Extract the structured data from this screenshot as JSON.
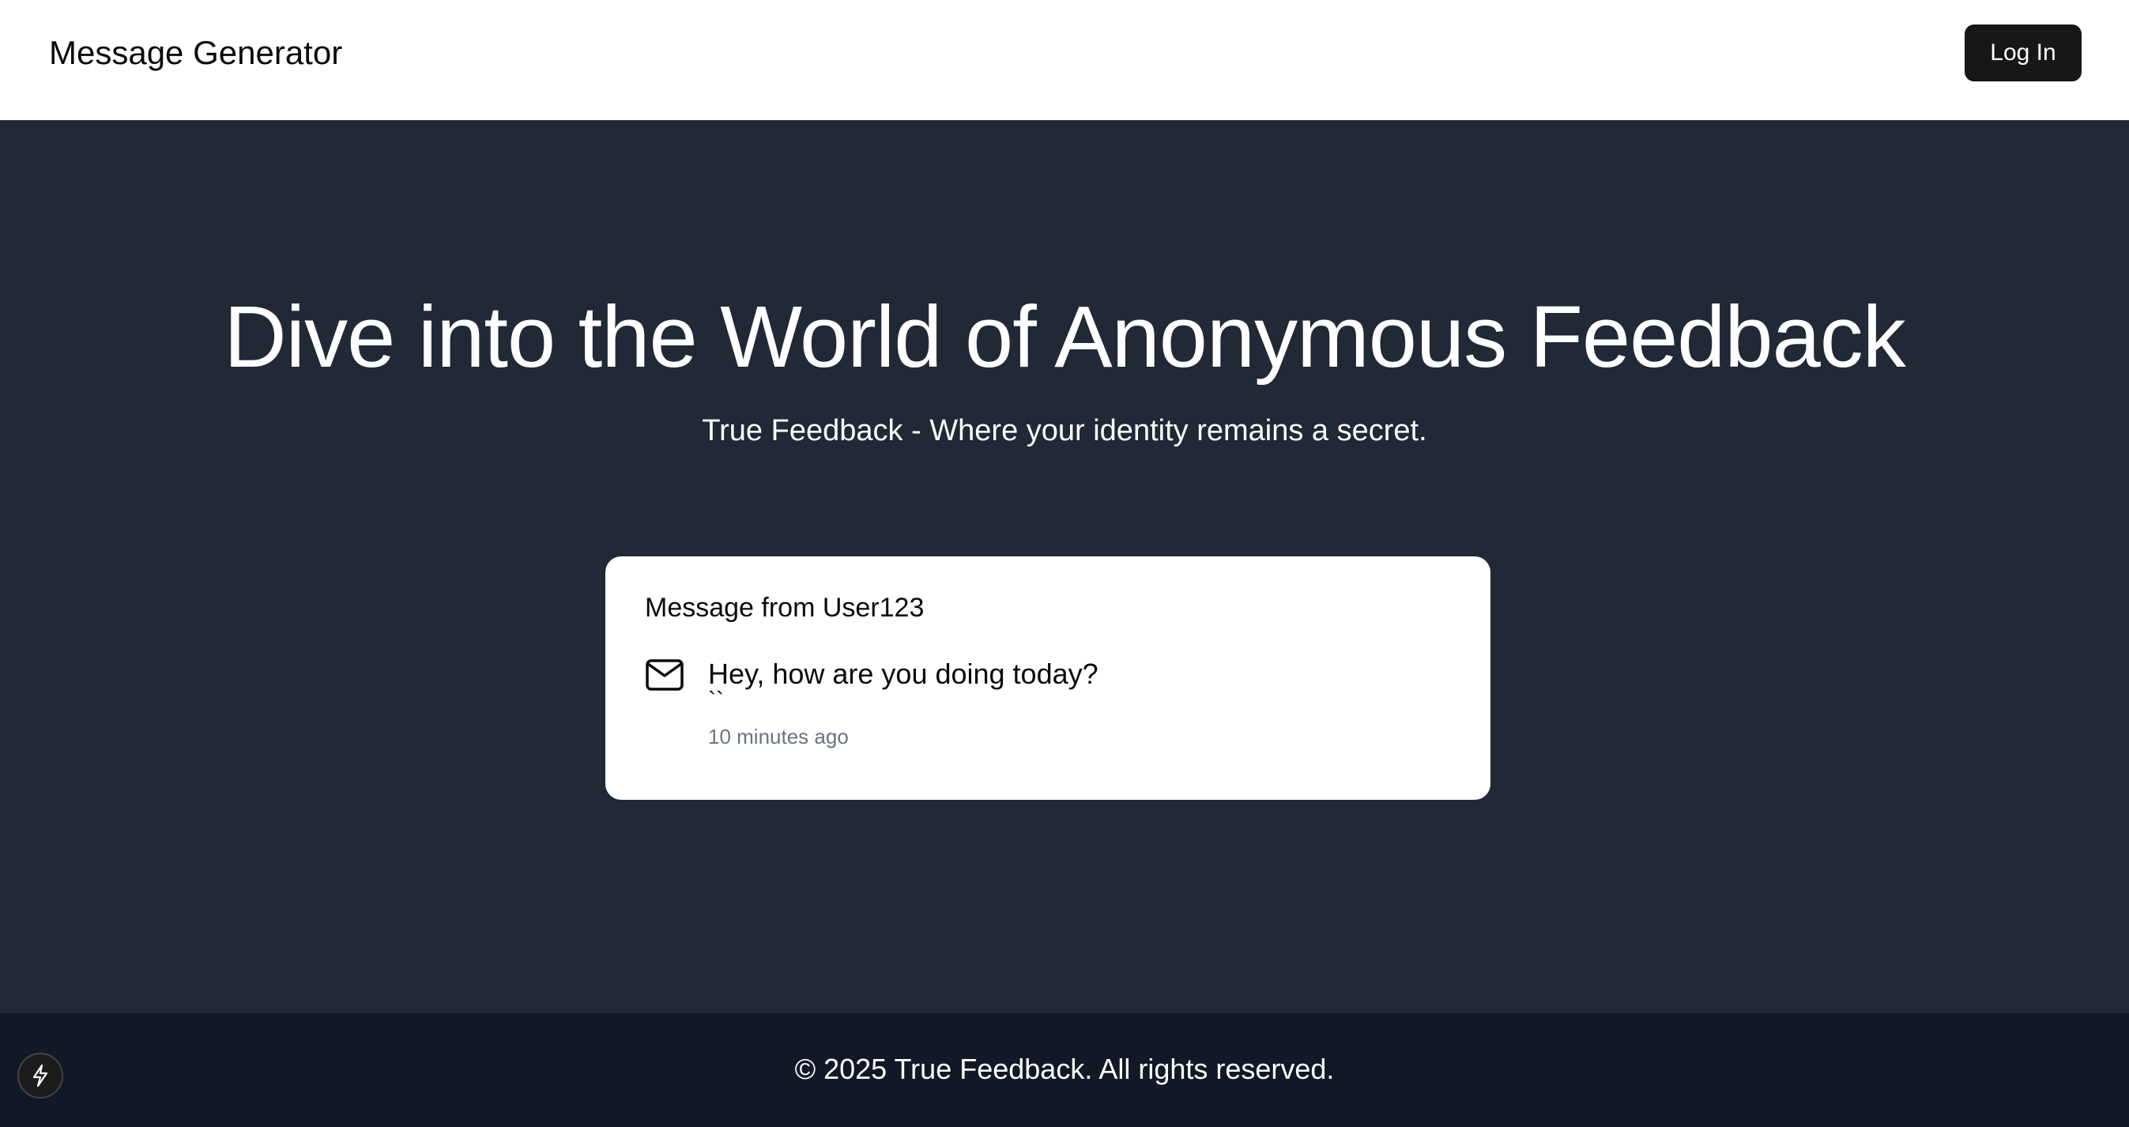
{
  "header": {
    "brand": "Message Generator",
    "login_label": "Log In"
  },
  "hero": {
    "title": "Dive into the World of Anonymous Feedback",
    "subtitle": "True Feedback - Where your identity remains a secret."
  },
  "message_card": {
    "title": "Message from User123",
    "icon": "mail-icon",
    "message": "Hey, how are you doing today?",
    "extra": "``",
    "time": "10 minutes ago"
  },
  "footer": {
    "text": "© 2025 True Feedback. All rights reserved.",
    "fab_icon": "lightning-icon"
  },
  "colors": {
    "header_bg": "#ffffff",
    "main_bg": "#212836",
    "footer_bg": "#131827",
    "button_bg": "#171717",
    "muted_text": "#6b7280"
  }
}
